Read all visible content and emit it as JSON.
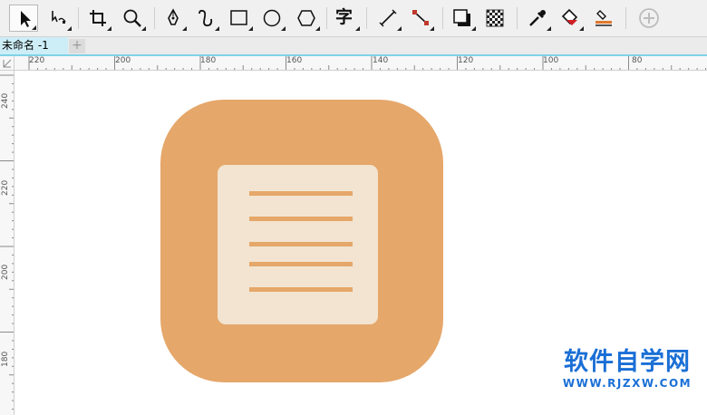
{
  "document": {
    "tab_title": "未命名 -1",
    "add_tab_symbol": "+"
  },
  "toolbar": {
    "tools": [
      {
        "name": "pick-tool",
        "icon": "arrow-pointer-icon",
        "active": true
      },
      {
        "name": "shape-tool",
        "icon": "node-edit-icon"
      },
      {
        "name": "crop-tool",
        "icon": "crop-icon"
      },
      {
        "name": "zoom-tool",
        "icon": "magnifier-icon"
      },
      {
        "name": "pen-tool",
        "icon": "pen-nib-icon"
      },
      {
        "name": "artistic-media-tool",
        "icon": "brush-curve-icon"
      },
      {
        "name": "rectangle-tool",
        "icon": "rectangle-icon"
      },
      {
        "name": "ellipse-tool",
        "icon": "ellipse-icon"
      },
      {
        "name": "polygon-tool",
        "icon": "hexagon-icon"
      },
      {
        "name": "text-tool",
        "icon": "text-glyph-icon",
        "label": "字"
      },
      {
        "name": "dimension-tool",
        "icon": "dimension-line-icon"
      },
      {
        "name": "connector-tool",
        "icon": "connector-line-icon"
      },
      {
        "name": "drop-shadow-tool",
        "icon": "drop-shadow-icon"
      },
      {
        "name": "transparency-tool",
        "icon": "checkerboard-icon"
      },
      {
        "name": "eyedropper-tool",
        "icon": "eyedropper-icon"
      },
      {
        "name": "interactive-fill-tool",
        "icon": "paint-bucket-icon"
      },
      {
        "name": "smart-fill-tool",
        "icon": "smart-fill-icon"
      },
      {
        "name": "add-tool",
        "icon": "plus-circle-icon"
      }
    ]
  },
  "rulers": {
    "horizontal_labels": [
      "220",
      "200",
      "180",
      "160",
      "140",
      "120",
      "100",
      "80"
    ],
    "vertical_labels": [
      "240",
      "220",
      "200",
      "180"
    ]
  },
  "artwork": {
    "icon_background_color": "#e5a76a",
    "card_color": "#f2e4d0",
    "line_color": "#e5a76a",
    "line_count": 5
  },
  "watermark": {
    "title": "软件自学网",
    "url": "WWW.RJZXW.COM",
    "color": "#1a6fd6"
  },
  "colors": {
    "toolbar_bg": "#f0f0f0",
    "tab_active_bg": "#cdeef7",
    "tab_accent": "#7fd3e7"
  }
}
